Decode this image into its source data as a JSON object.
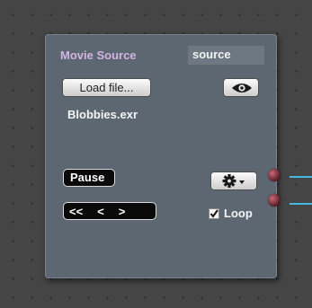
{
  "node": {
    "title": "Movie Source",
    "name_value": "source",
    "load_button_label": "Load file...",
    "filename": "Blobbies.exr",
    "pause_label": "Pause",
    "nav": {
      "rewind": "<<",
      "prev": "<",
      "next": ">"
    },
    "loop_label": "Loop",
    "loop_checked": true,
    "icons": {
      "preview": "eye-icon",
      "settings": "gear-icon",
      "menu": "chevron-down-icon"
    }
  },
  "colors": {
    "title": "#d3b4e3",
    "connection": "#45b8dc",
    "port": "#8e2f3b"
  }
}
